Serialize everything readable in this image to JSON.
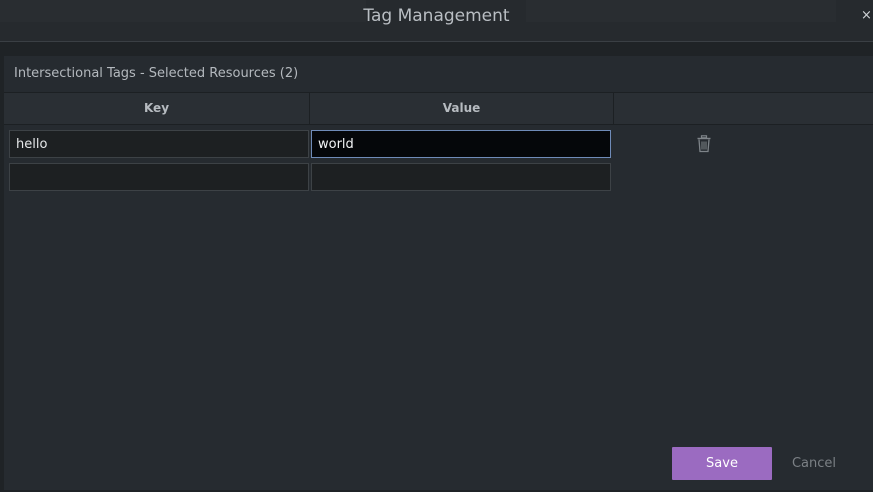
{
  "modal": {
    "title": "Tag Management",
    "close_glyph": "×"
  },
  "section": {
    "title": "Intersectional Tags - Selected Resources (2)"
  },
  "table": {
    "columns": [
      "Key",
      "Value",
      ""
    ],
    "rows": [
      {
        "key": "hello",
        "value": "world"
      },
      {
        "key": "",
        "value": ""
      }
    ],
    "row_action_icon": "trash-icon"
  },
  "footer": {
    "save_label": "Save",
    "cancel_label": "Cancel"
  },
  "colors": {
    "accent": "#9b6bc1",
    "focus_border": "#6f8bb8",
    "background": "#262b30"
  }
}
